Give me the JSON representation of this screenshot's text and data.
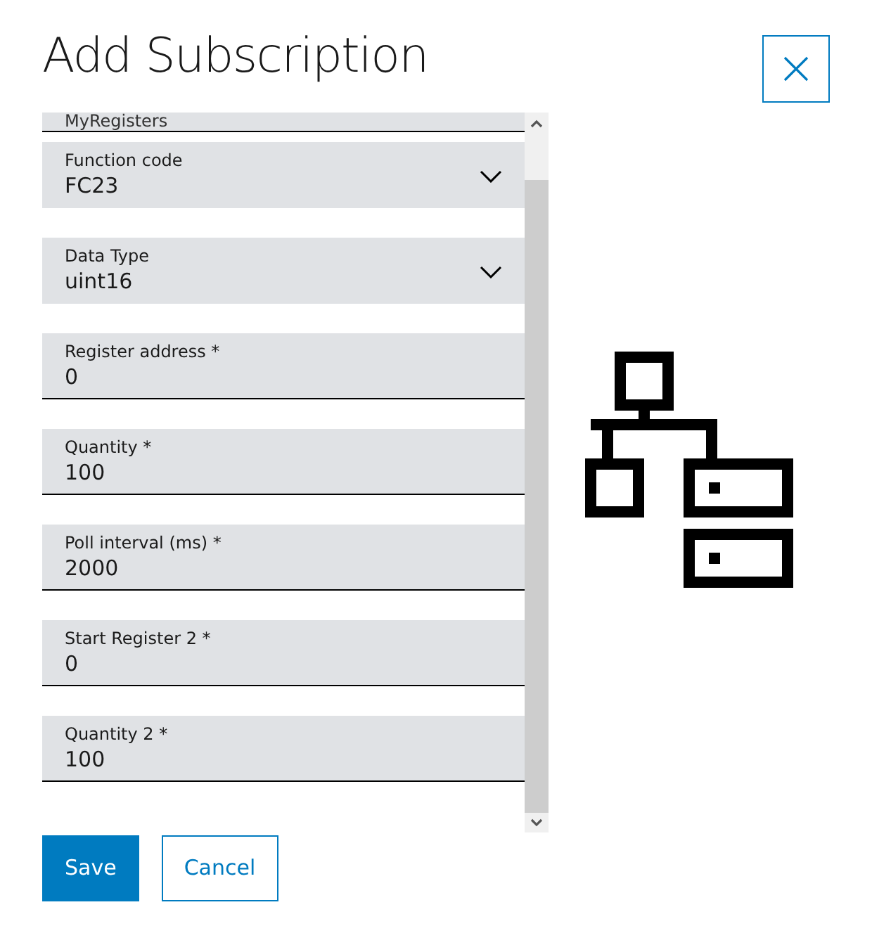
{
  "dialog": {
    "title": "Add Subscription"
  },
  "fields": [
    {
      "kind": "text",
      "value": "MyRegisters"
    },
    {
      "kind": "dropdown",
      "label": "Function code",
      "value": "FC23"
    },
    {
      "kind": "dropdown",
      "label": "Data Type",
      "value": "uint16"
    },
    {
      "kind": "text",
      "label": "Register address *",
      "value": "0"
    },
    {
      "kind": "text",
      "label": "Quantity *",
      "value": "100"
    },
    {
      "kind": "text",
      "label": "Poll interval (ms) *",
      "value": "2000"
    },
    {
      "kind": "text",
      "label": "Start Register 2 *",
      "value": "0"
    },
    {
      "kind": "text",
      "label": "Quantity 2 *",
      "value": "100"
    }
  ],
  "buttons": [
    {
      "kind": "primary",
      "label": "Save"
    },
    {
      "kind": "secondary",
      "label": "Cancel"
    }
  ]
}
